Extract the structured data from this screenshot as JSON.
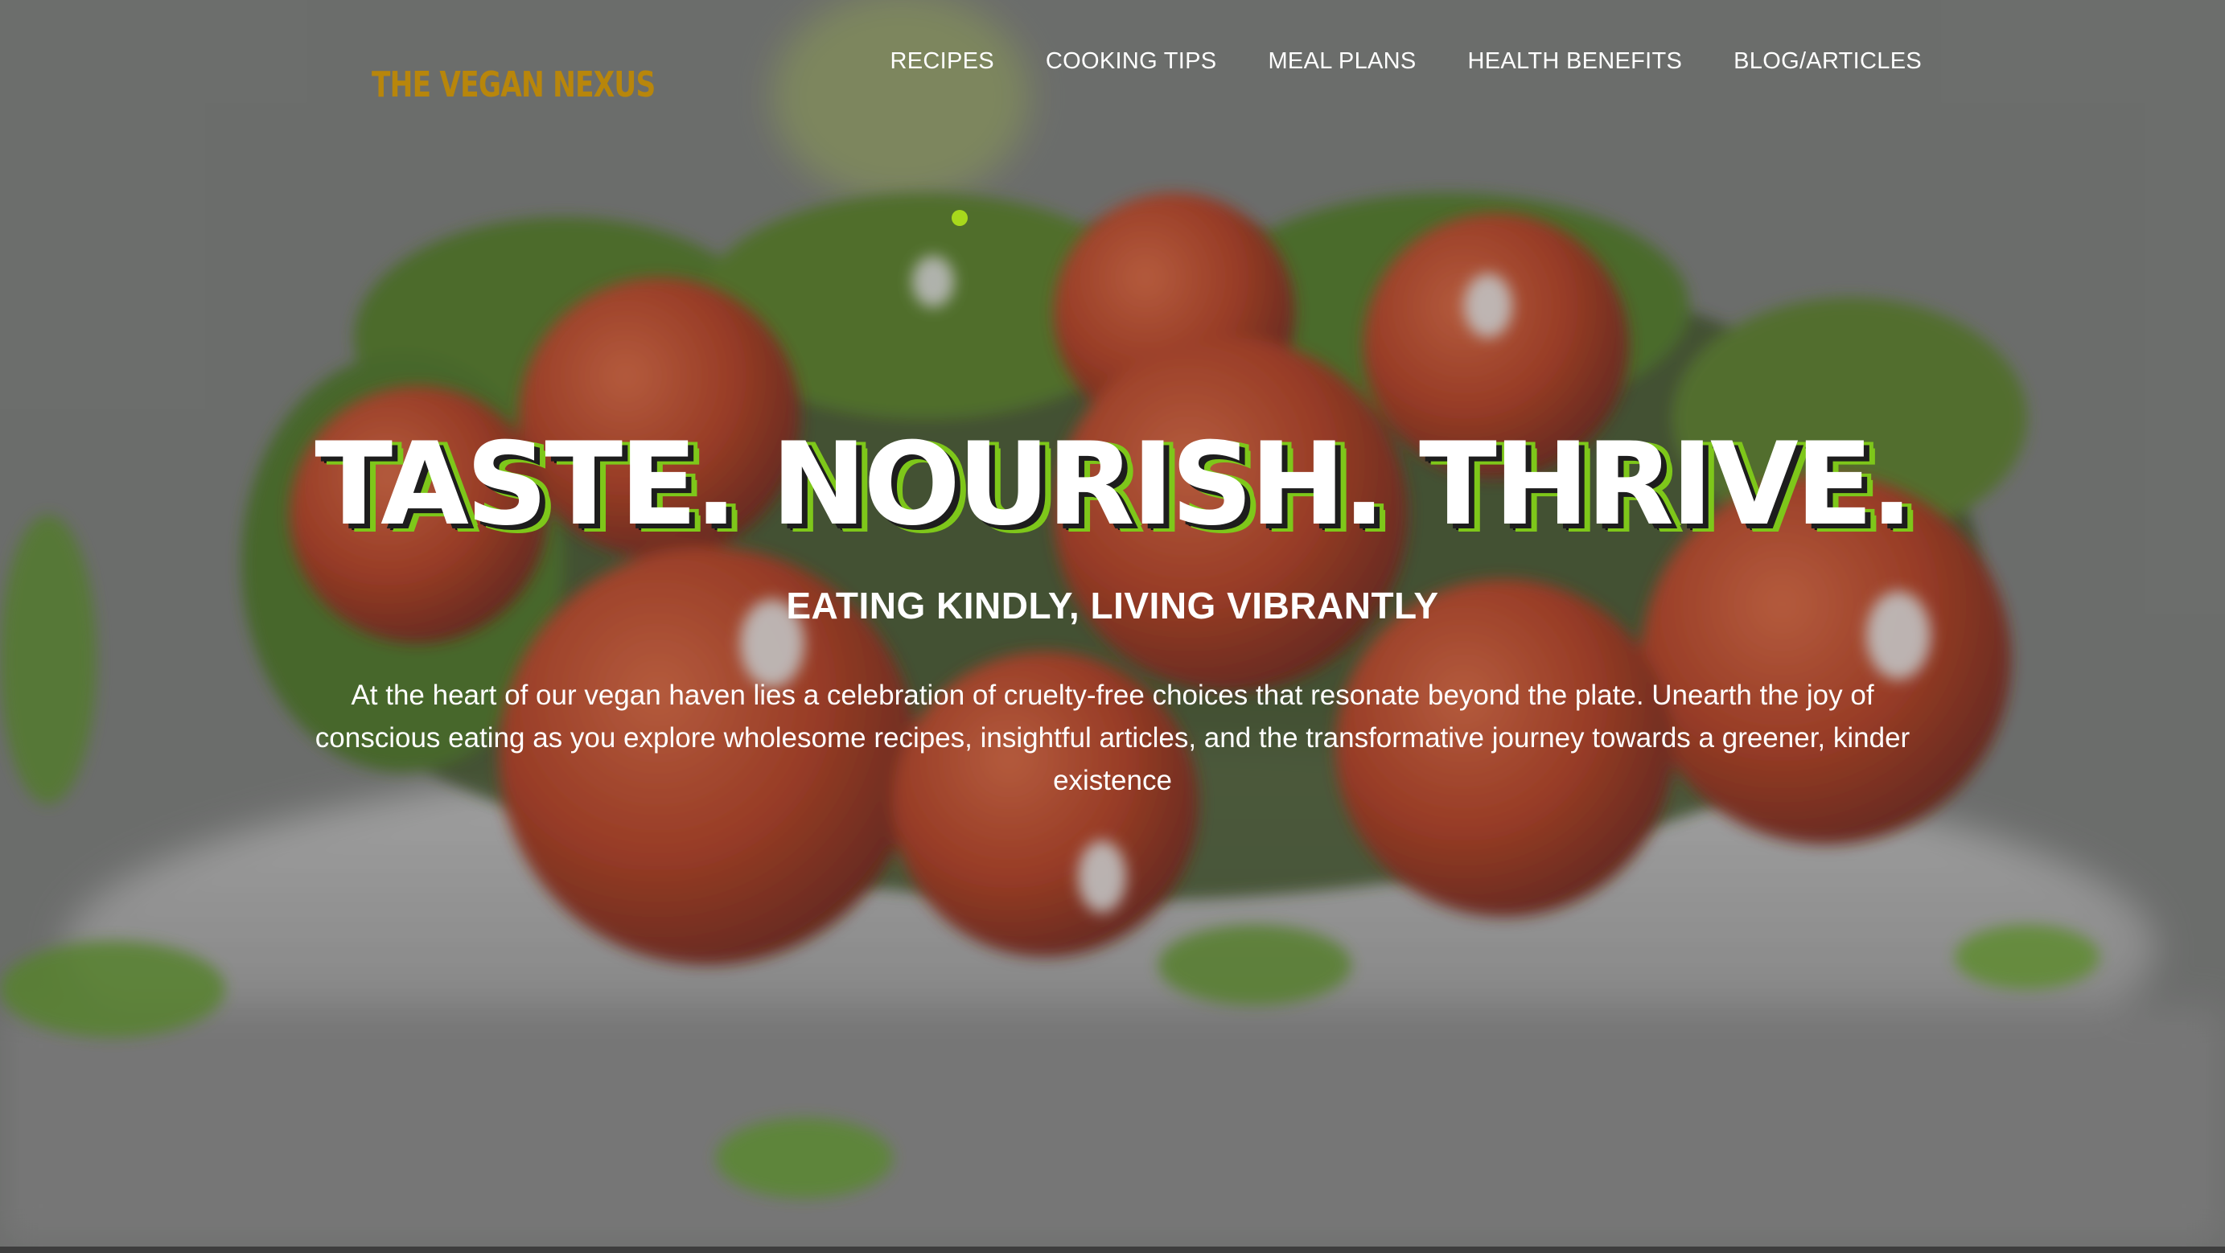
{
  "brand": {
    "logo_text": "THE VEGAN NEXUS"
  },
  "nav": {
    "items": [
      {
        "label": "RECIPES"
      },
      {
        "label": "COOKING TIPS"
      },
      {
        "label": "MEAL PLANS"
      },
      {
        "label": "HEALTH BENEFITS"
      },
      {
        "label": "BLOG/ARTICLES"
      }
    ]
  },
  "hero": {
    "headline": "TASTE. NOURISH. THRIVE.",
    "subheadline": "EATING KINDLY, LIVING VIBRANTLY",
    "intro": "At the heart of our vegan haven lies a celebration of cruelty-free choices that resonate beyond the plate. Unearth the joy of conscious eating as you explore wholesome recipes, insightful articles, and the transformative journey towards a greener, kinder existence",
    "background": "blurred bowl of tomatoes with fresh herbs"
  },
  "colors": {
    "accent": "#a8d81c",
    "logo": "#b8860b",
    "text": "#ffffff"
  }
}
